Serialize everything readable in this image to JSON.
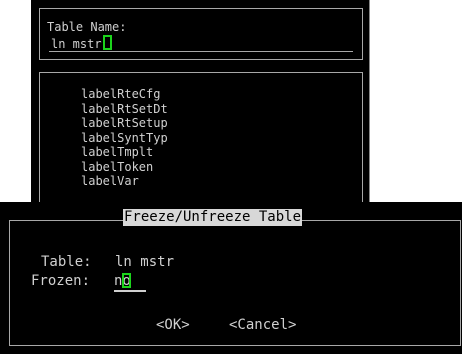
{
  "table_name_prompt": {
    "label": "Table Name:",
    "value": "ln mstr"
  },
  "table_list": {
    "items": [
      "labelRteCfg",
      "labelRtSetDt",
      "labelRtSetup",
      "labelSyntTyp",
      "labelTmplt",
      "labelToken",
      "labelVar"
    ]
  },
  "freeze_dialog": {
    "title": "Freeze/Unfreeze Table",
    "table_label": "Table:",
    "table_value": "ln mstr",
    "frozen_label": "Frozen:",
    "frozen_value": "no",
    "ok_button": "<OK>",
    "cancel_button": "<Cancel>"
  },
  "colors": {
    "background": "#000000",
    "text": "#d0d0d0",
    "cursor": "#1cd41c",
    "title_bar_bg": "#d8d8d8"
  }
}
